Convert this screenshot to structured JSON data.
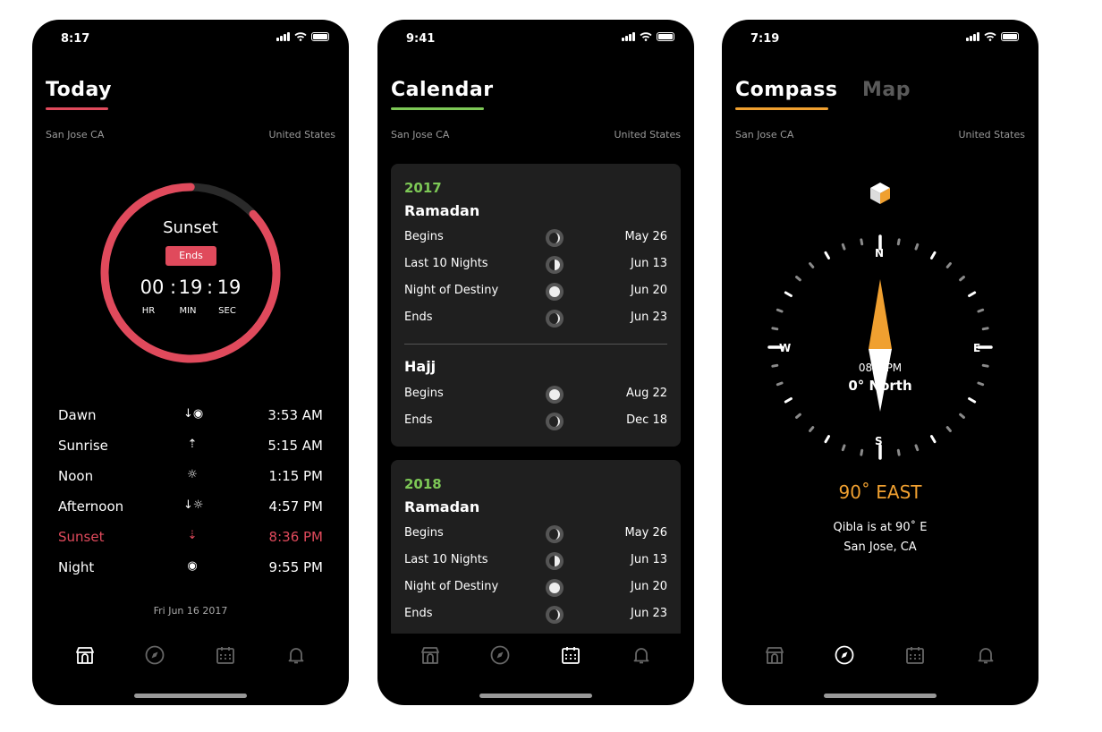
{
  "colors": {
    "accent_red": "#e04a5c",
    "accent_green": "#7dc856",
    "accent_orange": "#f0a030"
  },
  "today": {
    "status_time": "8:17",
    "title": "Today",
    "location": "San Jose CA",
    "country": "United States",
    "ring": {
      "label": "Sunset",
      "badge": "Ends",
      "hr": "00",
      "min": "19",
      "sec": "19",
      "hr_unit": "HR",
      "min_unit": "MIN",
      "sec_unit": "SEC",
      "progress": 0.87
    },
    "times": [
      {
        "name": "Dawn",
        "icon": "dawn-icon",
        "time": "3:53 AM"
      },
      {
        "name": "Sunrise",
        "icon": "sunrise-icon",
        "time": "5:15 AM"
      },
      {
        "name": "Noon",
        "icon": "sun-icon",
        "time": "1:15 PM"
      },
      {
        "name": "Afternoon",
        "icon": "afternoon-icon",
        "time": "4:57 PM"
      },
      {
        "name": "Sunset",
        "icon": "sunset-icon",
        "time": "8:36 PM"
      },
      {
        "name": "Night",
        "icon": "night-icon",
        "time": "9:55 PM"
      }
    ],
    "date": "Fri Jun 16 2017"
  },
  "calendar": {
    "status_time": "9:41",
    "title": "Calendar",
    "location": "San Jose CA",
    "country": "United States",
    "card1": {
      "year": "2017",
      "ramadan": {
        "title": "Ramadan",
        "rows": [
          {
            "label": "Begins",
            "date": "May 26"
          },
          {
            "label": "Last 10 Nights",
            "date": "Jun 13"
          },
          {
            "label": "Night of Destiny",
            "date": "Jun 20"
          },
          {
            "label": "Ends",
            "date": "Jun 23"
          }
        ]
      },
      "hajj": {
        "title": "Hajj",
        "rows": [
          {
            "label": "Begins",
            "date": "Aug 22"
          },
          {
            "label": "Ends",
            "date": "Dec 18"
          }
        ]
      }
    },
    "card2": {
      "year": "2018",
      "ramadan": {
        "title": "Ramadan",
        "rows": [
          {
            "label": "Begins",
            "date": "May 26"
          },
          {
            "label": "Last 10 Nights",
            "date": "Jun 13"
          },
          {
            "label": "Night of Destiny",
            "date": "Jun 20"
          },
          {
            "label": "Ends",
            "date": "Jun 23"
          }
        ]
      }
    }
  },
  "compass": {
    "status_time": "7:19",
    "tab_compass": "Compass",
    "tab_map": "Map",
    "location": "San Jose CA",
    "country": "United States",
    "n": "N",
    "s": "S",
    "e": "E",
    "w": "W",
    "overlay_time": "08:1 PM",
    "overlay_heading": "0° North",
    "direction": "90˚ EAST",
    "qibla": "Qibla is at 90˚ E",
    "city": "San Jose, CA"
  }
}
